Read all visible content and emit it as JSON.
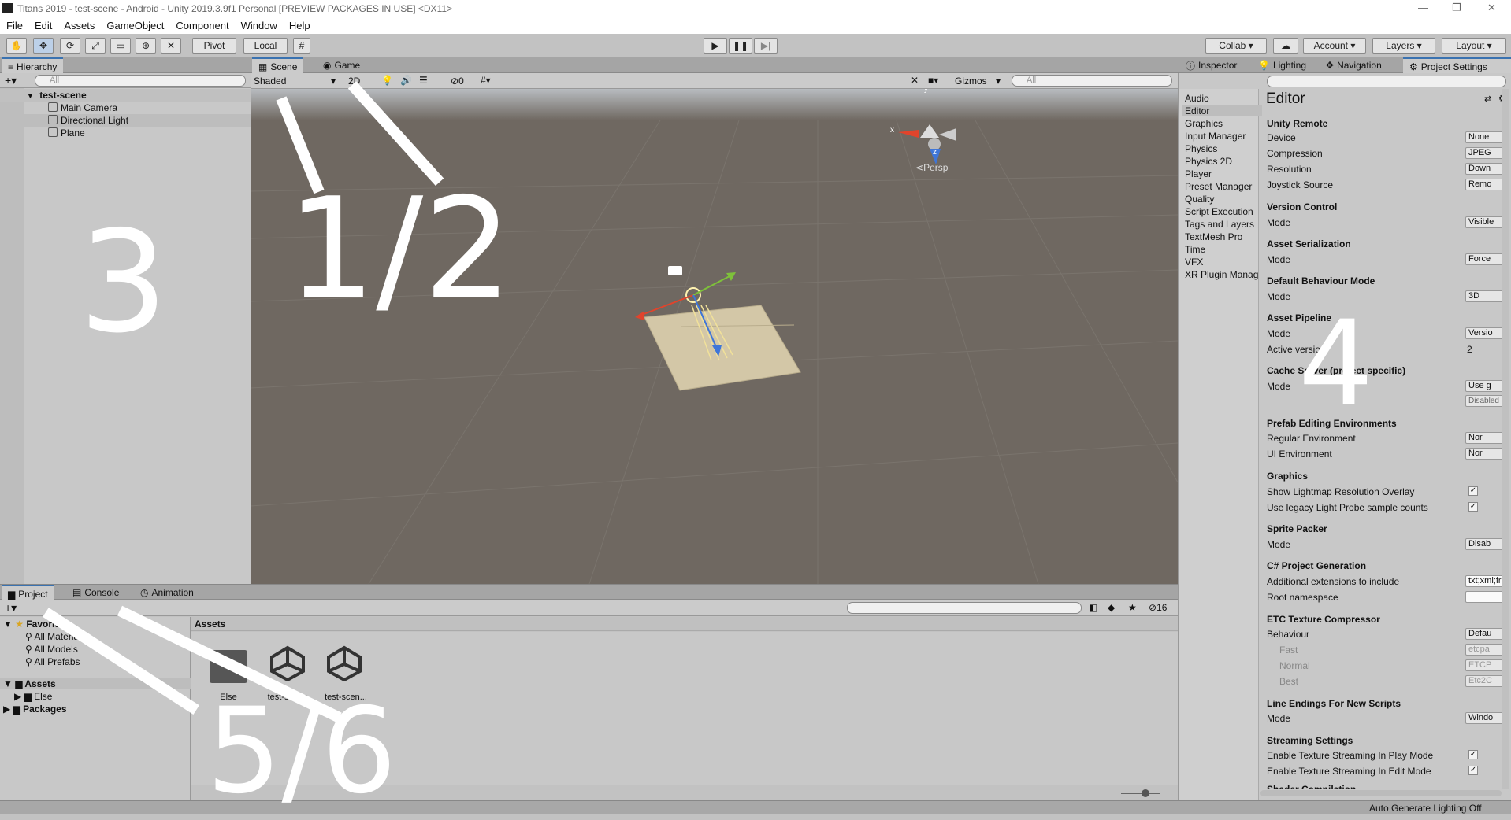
{
  "window": {
    "title": "Titans 2019 - test-scene - Android - Unity 2019.3.9f1 Personal [PREVIEW PACKAGES IN USE] <DX11>",
    "controls": [
      "—",
      "❐",
      "✕"
    ]
  },
  "menu": [
    "File",
    "Edit",
    "Assets",
    "GameObject",
    "Component",
    "Window",
    "Help"
  ],
  "toolbar": {
    "pivot_label": "Pivot",
    "local_label": "Local",
    "collab_label": "Collab ▾",
    "account_label": "Account",
    "layers_label": "Layers",
    "layout_label": "Layout"
  },
  "hierarchy": {
    "tab": "Hierarchy",
    "search_placeholder": "All",
    "scene": "test-scene",
    "items": [
      "Main Camera",
      "Directional Light",
      "Plane"
    ]
  },
  "scene_view": {
    "tabs": [
      "Scene",
      "Game"
    ],
    "shading": "Shaded",
    "mode_2d": "2D",
    "hidden_count": "0",
    "gizmos_label": "Gizmos",
    "search_placeholder": "All",
    "persp_label": "Persp",
    "axis_x": "x",
    "axis_y": "y",
    "axis_z": "z"
  },
  "inspector": {
    "tabs": [
      "Inspector",
      "Lighting",
      "Navigation",
      "Project Settings"
    ],
    "settings_categories": [
      "Audio",
      "Editor",
      "Graphics",
      "Input Manager",
      "Physics",
      "Physics 2D",
      "Player",
      "Preset Manager",
      "Quality",
      "Script Execution",
      "Tags and Layers",
      "TextMesh Pro",
      "Time",
      "VFX",
      "XR Plugin Manag"
    ],
    "selected_category": "Editor",
    "heading": "Editor",
    "sections": {
      "unity_remote": "Unity Remote",
      "device": "Device",
      "device_val": "None",
      "compression": "Compression",
      "compression_val": "JPEG",
      "resolution": "Resolution",
      "resolution_val": "Down",
      "joystick": "Joystick Source",
      "joystick_val": "Remo",
      "version_control": "Version Control",
      "vc_mode": "Mode",
      "vc_mode_val": "Visible",
      "asset_serialization": "Asset Serialization",
      "as_mode": "Mode",
      "as_mode_val": "Force",
      "default_behaviour": "Default Behaviour Mode",
      "db_mode": "Mode",
      "db_mode_val": "3D",
      "asset_pipeline": "Asset Pipeline",
      "ap_mode": "Mode",
      "ap_mode_val": "Versio",
      "active_version": "Active version",
      "active_version_val": "2",
      "cache_server": "Cache Server (project specific)",
      "cs_mode": "Mode",
      "cs_mode_val": "Use g",
      "cs_disabled": "Disabled",
      "prefab_editing": "Prefab Editing Environments",
      "regular_env": "Regular Environment",
      "regular_env_val": "Nor",
      "ui_env": "UI Environment",
      "ui_env_val": "Nor",
      "graphics": "Graphics",
      "show_lightmap": "Show Lightmap Resolution Overlay",
      "legacy_probe": "Use legacy Light Probe sample counts",
      "sprite_packer": "Sprite Packer",
      "sp_mode": "Mode",
      "sp_mode_val": "Disab",
      "csharp_gen": "C# Project Generation",
      "additional_ext": "Additional extensions to include",
      "additional_ext_val": "txt;xml;fr",
      "root_ns": "Root namespace",
      "etc_compressor": "ETC Texture Compressor",
      "behaviour": "Behaviour",
      "behaviour_val": "Defau",
      "fast": "Fast",
      "fast_val": "etcpa",
      "normal": "Normal",
      "normal_val": "ETCP",
      "best": "Best",
      "best_val": "Etc2C",
      "line_endings": "Line Endings For New Scripts",
      "le_mode": "Mode",
      "le_mode_val": "Windo",
      "streaming": "Streaming Settings",
      "stream_play": "Enable Texture Streaming In Play Mode",
      "stream_edit": "Enable Texture Streaming In Edit Mode",
      "cut_off": "Shader Compilation"
    }
  },
  "project": {
    "tabs": [
      "Project",
      "Console",
      "Animation"
    ],
    "favorites": "Favorites",
    "fav_items": [
      "All Materials",
      "All Models",
      "All Prefabs"
    ],
    "assets_root": "Assets",
    "assets_children": [
      "Else"
    ],
    "packages": "Packages",
    "breadcrumb": "Assets",
    "hidden_count": "16",
    "assets": [
      "Else",
      "test-scene",
      "test-scen..."
    ]
  },
  "annotations": {
    "label_1_2": "1/2",
    "label_3": "3",
    "label_4": "4",
    "label_5_6": "5/6"
  },
  "status": "Auto Generate Lighting Off"
}
